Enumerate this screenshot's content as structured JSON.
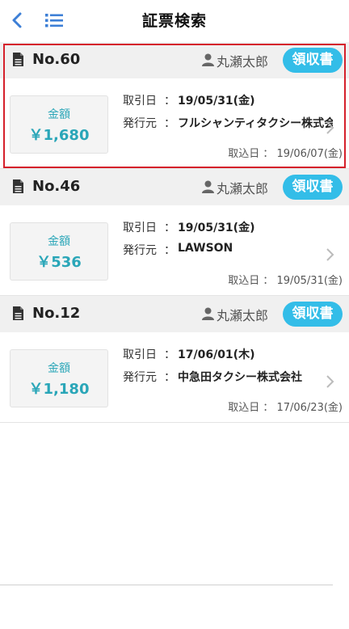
{
  "header": {
    "title": "証票検索",
    "back_icon": "chevron-left-icon",
    "list_icon": "list-icon",
    "accent": "#3d7fd6"
  },
  "colors": {
    "receipt_button": "#33bde8",
    "amount_text": "#2aa6b8",
    "highlight_border": "#d5202b"
  },
  "cards": [
    {
      "no": "No.60",
      "user": "丸瀬太郎",
      "badge": "領収書",
      "amount_label": "金額",
      "amount": "￥1,680",
      "deal_date_label": "取引日",
      "deal_date": "19/05/31(金)",
      "issuer_label": "発行元",
      "issuer": "フルシャンティタクシー株式会社",
      "colon": "：",
      "import_label": "取込日 ： 19/06/07(金)"
    },
    {
      "no": "No.46",
      "user": "丸瀬太郎",
      "badge": "領収書",
      "amount_label": "金額",
      "amount": "￥536",
      "deal_date_label": "取引日",
      "deal_date": "19/05/31(金)",
      "issuer_label": "発行元",
      "issuer": "LAWSON",
      "colon": "：",
      "import_label": "取込日 ： 19/05/31(金)"
    },
    {
      "no": "No.12",
      "user": "丸瀬太郎",
      "badge": "領収書",
      "amount_label": "金額",
      "amount": "￥1,180",
      "deal_date_label": "取引日",
      "deal_date": "17/06/01(木)",
      "issuer_label": "発行元",
      "issuer": "中急田タクシー株式会社",
      "colon": "：",
      "import_label": "取込日 ： 17/06/23(金)"
    }
  ]
}
